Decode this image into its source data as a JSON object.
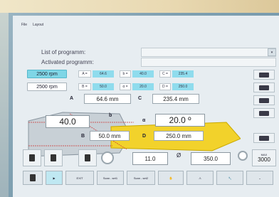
{
  "menu": {
    "file": "File",
    "layout": "Layout"
  },
  "header": {
    "line1": "",
    "line2": ""
  },
  "programs": {
    "list_label": "List of programm:",
    "list_value": "",
    "activated_label": "Activated programm:",
    "activated_value": ""
  },
  "speeds": {
    "rpm_cyan": "2500 rpm",
    "rpm_white": "2500 rpm"
  },
  "params": [
    {
      "key": "A =",
      "value": "64.6"
    },
    {
      "key": "B =",
      "value": "50.0"
    },
    {
      "key": "b =",
      "value": "40.0"
    },
    {
      "key": "α =",
      "value": "20.0"
    },
    {
      "key": "C =",
      "value": "235.4"
    },
    {
      "key": "D =",
      "value": "250.0"
    }
  ],
  "dims": {
    "A_label": "A",
    "A_value": "64.6 mm",
    "C_label": "C",
    "C_value": "235.4 mm",
    "b_label": "b",
    "b_value": "40.0",
    "alpha_label": "α",
    "alpha_value": "20.0 º",
    "B_label": "B",
    "B_value": "50.0 mm",
    "D_label": "D",
    "D_value": "250.0 mm"
  },
  "bottom_row": {
    "val1": "11.0",
    "diam_symbol": "Ø",
    "val2": "350.0",
    "max_label": "MAX",
    "max_value": "3000"
  },
  "toolbar": {
    "btn3": "EXIT",
    "btn4": "Scan - set1",
    "btn5": "Scan - set2"
  },
  "colors": {
    "cyan": "#7fd6e6",
    "yellow": "#f2d22b",
    "screen_bg": "#e7edf1"
  }
}
